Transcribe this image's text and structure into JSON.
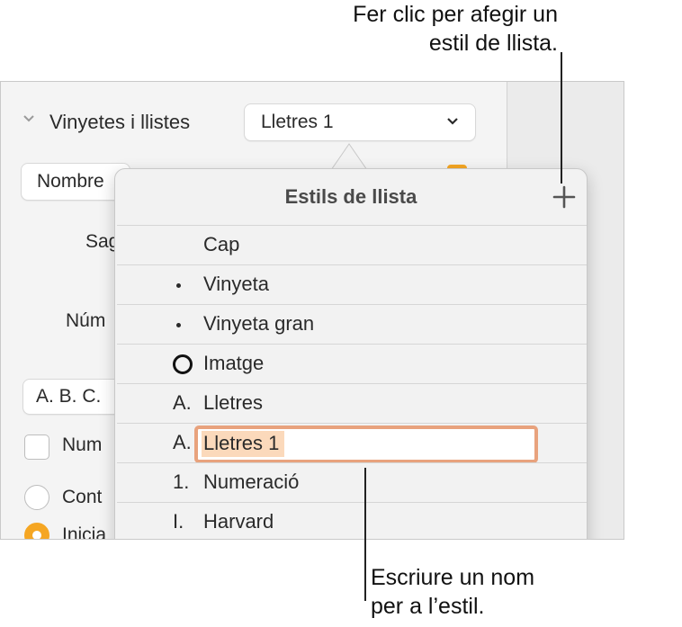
{
  "callouts": {
    "add_style": [
      "Fer clic per afegir un",
      "estil de llista."
    ],
    "type_name": [
      "Escriure un nom",
      "per a l’estil."
    ]
  },
  "inspector": {
    "section_title": "Vinyetes i llistes",
    "list_style_value": "Lletres 1",
    "type_value": "Nombre",
    "labels": {
      "sagnat": "Sag",
      "numeracio": "Núm",
      "numerar_check": "Num",
      "continuar_radio": "Cont",
      "iniciar_radio": "Inicia"
    },
    "format_value": "A. B. C."
  },
  "popover": {
    "title": "Estils de llista",
    "add_icon": "plus-icon",
    "items": [
      {
        "marker": "",
        "label": "Cap"
      },
      {
        "marker": "•",
        "label": "Vinyeta"
      },
      {
        "marker": "•",
        "label": "Vinyeta gran"
      },
      {
        "marker": "○",
        "label": "Imatge"
      },
      {
        "marker": "A.",
        "label": "Lletres"
      },
      {
        "marker": "A.",
        "label": "Lletres 1",
        "editing": true
      },
      {
        "marker": "1.",
        "label": "Numeració"
      },
      {
        "marker": "I.",
        "label": "Harvard"
      }
    ]
  },
  "colors": {
    "accent_orange": "#f5a623",
    "edit_field_border": "#e8a27d",
    "selection_highlight": "#fbd9bb"
  }
}
